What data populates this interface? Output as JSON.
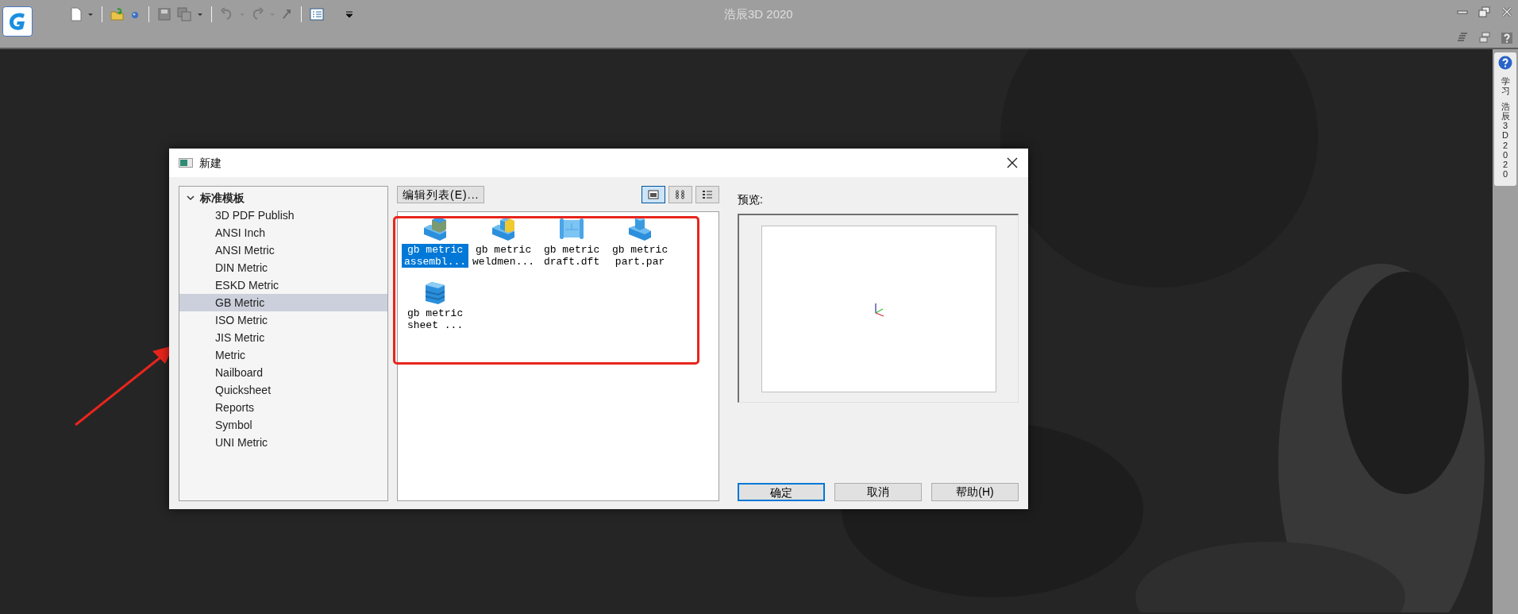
{
  "app": {
    "title": "浩辰3D 2020"
  },
  "side_tab": {
    "texts": [
      "学习",
      "浩辰3D 2020"
    ]
  },
  "dialog": {
    "title": "新建",
    "tree": {
      "label": "标准模板",
      "expanded": true,
      "children": [
        {
          "label": "3D PDF Publish",
          "selected": false
        },
        {
          "label": "ANSI Inch",
          "selected": false
        },
        {
          "label": "ANSI Metric",
          "selected": false
        },
        {
          "label": "DIN Metric",
          "selected": false
        },
        {
          "label": "ESKD Metric",
          "selected": false
        },
        {
          "label": "GB Metric",
          "selected": true
        },
        {
          "label": "ISO Metric",
          "selected": false
        },
        {
          "label": "JIS Metric",
          "selected": false
        },
        {
          "label": "Metric",
          "selected": false
        },
        {
          "label": "Nailboard",
          "selected": false
        },
        {
          "label": "Quicksheet",
          "selected": false
        },
        {
          "label": "Reports",
          "selected": false
        },
        {
          "label": "Symbol",
          "selected": false
        },
        {
          "label": "UNI Metric",
          "selected": false
        }
      ]
    },
    "edit_button": "编辑列表(E)...",
    "view_modes": [
      {
        "kind": "large",
        "selected": true
      },
      {
        "kind": "small",
        "selected": false
      },
      {
        "kind": "list",
        "selected": false
      }
    ],
    "templates": [
      {
        "name": "gb metric assembl...",
        "kind": "assembly",
        "selected": true
      },
      {
        "name": "gb metric weldmen...",
        "kind": "weldment",
        "selected": false
      },
      {
        "name": "gb metric draft.dft",
        "kind": "draft",
        "selected": false
      },
      {
        "name": "gb metric part.par",
        "kind": "part",
        "selected": false
      },
      {
        "name": "gb metric sheet ...",
        "kind": "sheet",
        "selected": false
      }
    ],
    "preview_label": "预览:",
    "buttons": [
      {
        "label": "确定",
        "default": true
      },
      {
        "label": "取消",
        "default": false
      },
      {
        "label": "帮助(H)",
        "default": false
      }
    ]
  }
}
